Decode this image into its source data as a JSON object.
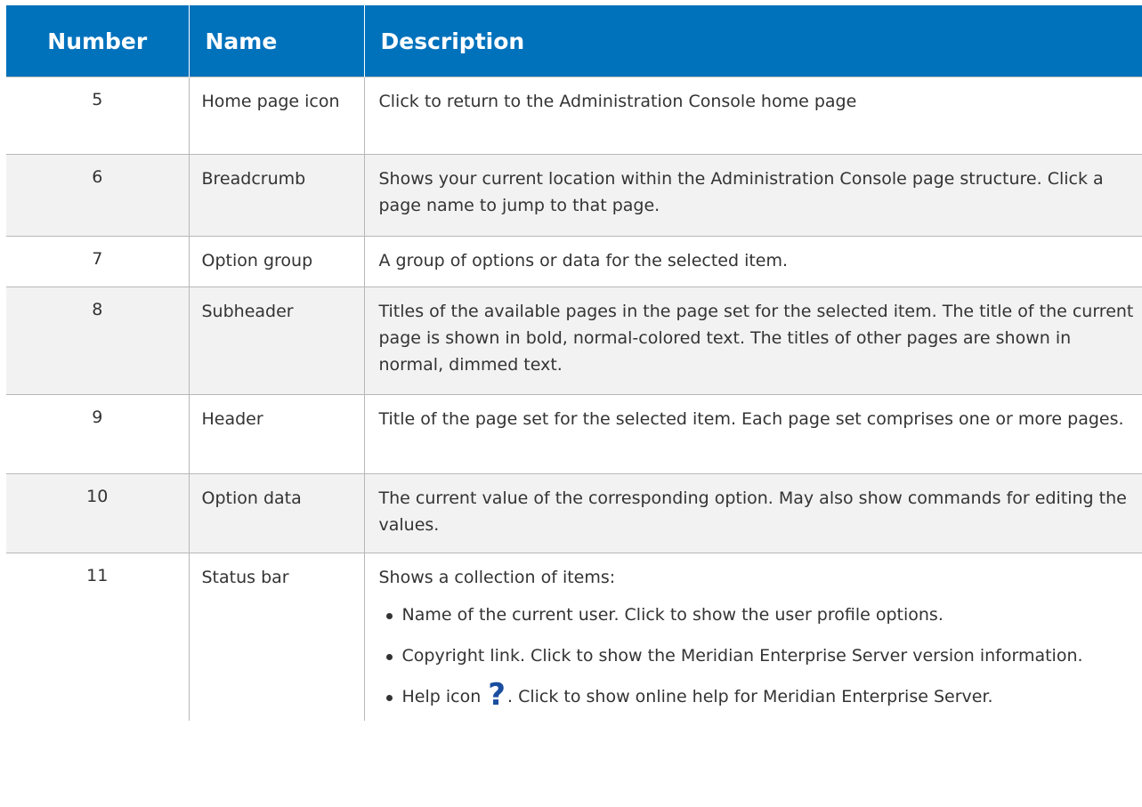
{
  "table": {
    "headers": {
      "number": "Number",
      "name": "Name",
      "description": "Description"
    },
    "rows": [
      {
        "number": "5",
        "name": "Home page icon",
        "description": "Click to return to the Administration Console home page"
      },
      {
        "number": "6",
        "name": "Breadcrumb",
        "description": "Shows your current location within the Administration Console page structure. Click a page name to jump to that page."
      },
      {
        "number": "7",
        "name": "Option group",
        "description": "A group of options or data for the selected item."
      },
      {
        "number": "8",
        "name": "Subheader",
        "description": "Titles of the available pages in the page set for the selected item. The title of the current page is shown in bold, normal-colored text. The titles of other pages are shown in normal, dimmed text."
      },
      {
        "number": "9",
        "name": "Header",
        "description": "Title of the page set for the selected item. Each page set comprises one or more pages."
      },
      {
        "number": "10",
        "name": "Option data",
        "description": "The current value of the corresponding option. May also show commands for editing the values."
      },
      {
        "number": "11",
        "name": "Status bar",
        "description": "Shows a collection of items:",
        "bullets": [
          "Name of the current user. Click to show the user profile options.",
          "Copyright link. Click to show the Meridian Enterprise Server version information."
        ],
        "help_bullet": {
          "before": "Help icon",
          "icon": "help-icon",
          "glyph": "?",
          "after": ". Click to show online help for Meridian Enterprise Server."
        }
      }
    ]
  },
  "colors": {
    "header_bg": "#0072bc",
    "header_text": "#ffffff",
    "alt_row_bg": "#f2f2f2",
    "help_icon": "#1a4e9e"
  }
}
